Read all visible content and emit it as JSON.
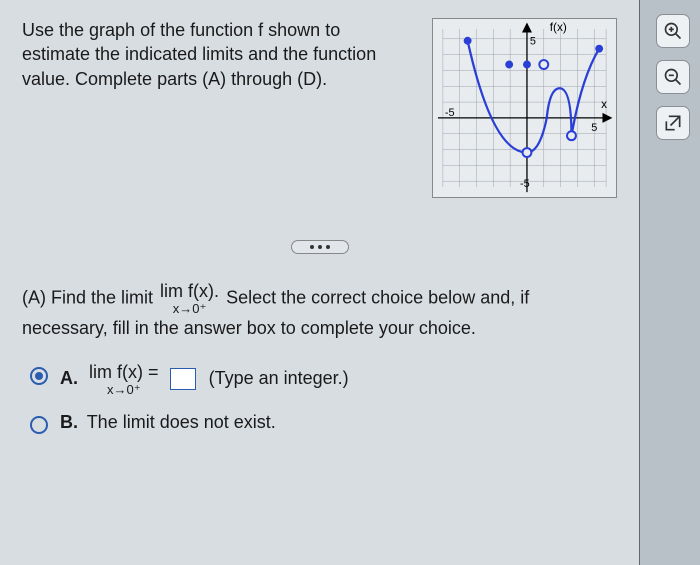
{
  "instructions": "Use the graph of the function f shown to estimate the indicated limits and the function value. Complete parts (A) through (D).",
  "graph": {
    "y_label": "f(x)",
    "x_label": "x",
    "x_ticks": [
      "-5",
      "5"
    ],
    "y_ticks": [
      "5",
      "-5"
    ]
  },
  "partA": {
    "prompt_pre": "(A) Find the limit ",
    "lim_top": "lim",
    "lim_expr": "f(x).",
    "lim_sub": "x→0⁺",
    "prompt_post": " Select the correct choice below and, if necessary, fill in the answer box to complete your choice.",
    "choices": {
      "A": {
        "letter": "A.",
        "lim_top": "lim",
        "lim_expr": "f(x) =",
        "lim_sub": "x→0⁺",
        "hint": "(Type an integer.)",
        "selected": true
      },
      "B": {
        "letter": "B.",
        "text": "The limit does not exist.",
        "selected": false
      }
    }
  },
  "tools": {
    "zoom_in": "zoom-in-icon",
    "zoom_out": "zoom-out-icon",
    "open_ext": "external-link-icon"
  }
}
